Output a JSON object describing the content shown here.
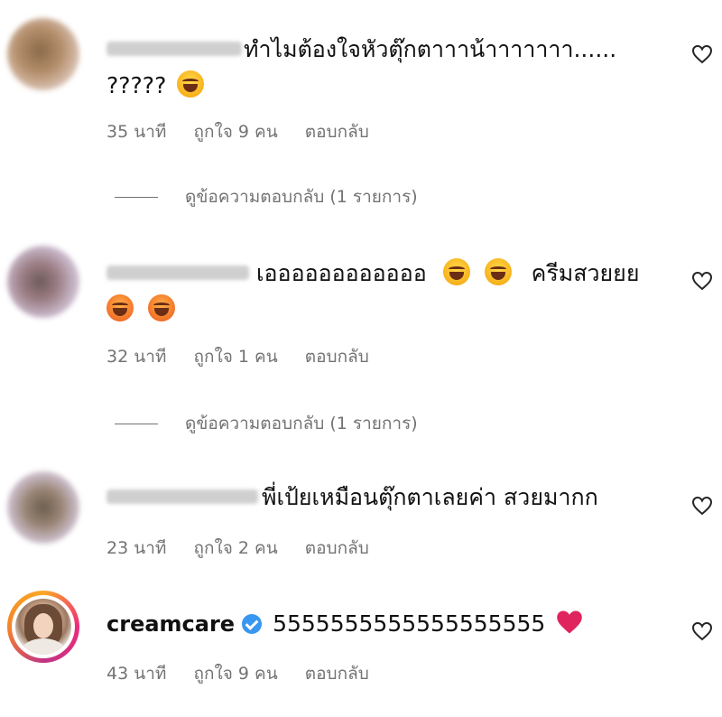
{
  "comments": [
    {
      "line1": "ทำไมต้องใจหัวตุ๊กตาาาน้าาาาาาา......",
      "line2": "?????",
      "meta": {
        "time": "35 นาที",
        "likes": "ถูกใจ 9 คน",
        "reply": "ตอบกลับ"
      },
      "view_replies": "ดูข้อความตอบกลับ (1 รายการ)"
    },
    {
      "line1": "เออออออออออออ",
      "line1_suffix": "ครีมสวยยย",
      "meta": {
        "time": "32 นาที",
        "likes": "ถูกใจ 1 คน",
        "reply": "ตอบกลับ"
      },
      "view_replies": "ดูข้อความตอบกลับ (1 รายการ)"
    },
    {
      "line1": "พี่เป้ยเหมือนตุ๊กตาเลยค่า สวยมากก",
      "meta": {
        "time": "23 นาที",
        "likes": "ถูกใจ 2 คน",
        "reply": "ตอบกลับ"
      }
    },
    {
      "username": "creamcare",
      "line1": "5555555555555555555",
      "meta": {
        "time": "43 นาที",
        "likes": "ถูกใจ 9 คน",
        "reply": "ตอบกลับ"
      }
    }
  ],
  "icons": {
    "like": "heart-outline-icon",
    "verified": "verified-badge-icon",
    "emoji_laugh": "face-with-tears-of-joy-icon",
    "emoji_squint": "grinning-squinting-face-icon",
    "red_heart": "red-heart-icon"
  },
  "colors": {
    "verified": "#3897f0",
    "meta_text": "#737373",
    "heart_red": "#e0245e"
  }
}
